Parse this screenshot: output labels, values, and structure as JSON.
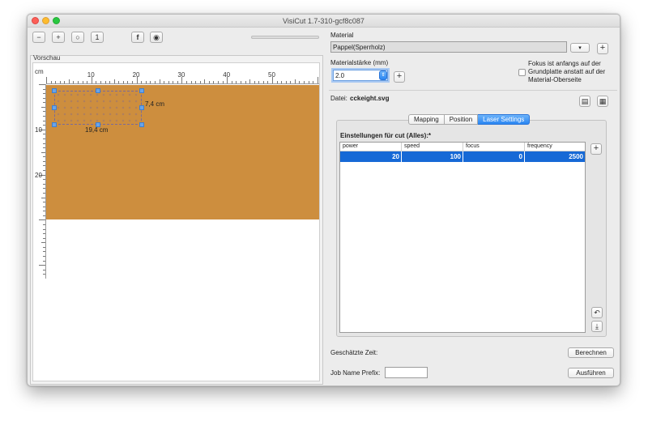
{
  "window": {
    "title": "VisiCut 1.7-310-gcf8c087"
  },
  "toolbar": {
    "buttons": [
      {
        "name": "zoom-out",
        "icon": "−"
      },
      {
        "name": "zoom-in",
        "icon": "+"
      },
      {
        "name": "zoom-reset",
        "icon": "○"
      },
      {
        "name": "zoom-fit",
        "icon": "1"
      },
      {
        "name": "facebook",
        "icon": "f"
      },
      {
        "name": "camera",
        "icon": "◉"
      }
    ]
  },
  "preview": {
    "label": "Vorschau",
    "unit": "cm",
    "ruler_h_labels": [
      "10",
      "20",
      "30",
      "40",
      "50"
    ],
    "ruler_v_labels": [
      "10",
      "20"
    ],
    "width_label": "19,4 cm",
    "height_label": "7,4 cm",
    "board_color": "#cd8e3e"
  },
  "material": {
    "label": "Material",
    "value": "Pappel(Sperrholz)",
    "add_label": "+",
    "thickness_label": "Materialstärke (mm)",
    "thickness_value": "2.0",
    "thickness_add": "+",
    "focus_text": "Fokus ist anfangs auf der Grundplatte anstatt auf der Material-Oberseite"
  },
  "file": {
    "label": "Datei:",
    "name": "cckeight.svg"
  },
  "tabs": [
    {
      "label": "Mapping",
      "active": false
    },
    {
      "label": "Position",
      "active": false
    },
    {
      "label": "Laser Settings",
      "active": true
    }
  ],
  "laser_settings": {
    "heading": "Einstellungen für cut (Alles):*",
    "columns": [
      "power",
      "speed",
      "focus",
      "frequency"
    ],
    "rows": [
      [
        "20",
        "100",
        "0",
        "2500"
      ]
    ],
    "add_label": "+"
  },
  "bottom": {
    "time_label": "Geschätzte Zeit:",
    "compute_button": "Berechnen",
    "prefix_label": "Job Name Prefix:",
    "prefix_value": "",
    "execute_button": "Ausführen"
  },
  "colors": {
    "accent": "#2a86f2",
    "selection": "#1669d6"
  }
}
